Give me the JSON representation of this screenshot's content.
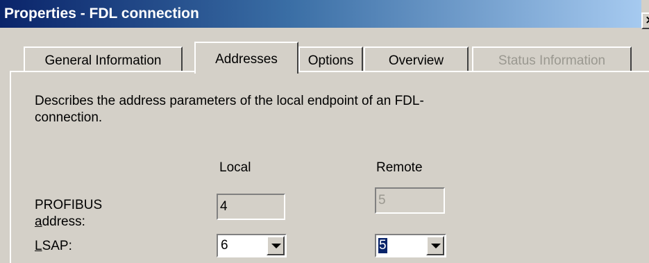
{
  "window": {
    "title": "Properties - FDL connection",
    "close_label": "×"
  },
  "tabs": [
    {
      "label": "General Information",
      "active": false,
      "enabled": true
    },
    {
      "label": "Addresses",
      "active": true,
      "enabled": true
    },
    {
      "label": "Options",
      "active": false,
      "enabled": true
    },
    {
      "label": "Overview",
      "active": false,
      "enabled": true
    },
    {
      "label": "Status Information",
      "active": false,
      "enabled": false
    }
  ],
  "addresses": {
    "description": "Describes the address parameters of the local endpoint of an FDL-connection.",
    "columns": {
      "local": "Local",
      "remote": "Remote"
    },
    "profibus": {
      "label_line1": "PROFIBUS",
      "label_line2_mnemonic": "a",
      "label_line2_rest": "ddress:",
      "local_value": "4",
      "remote_value": "5"
    },
    "lsap": {
      "label_mnemonic": "L",
      "label_rest": "SAP:",
      "local_value": "6",
      "remote_value": "5"
    }
  }
}
